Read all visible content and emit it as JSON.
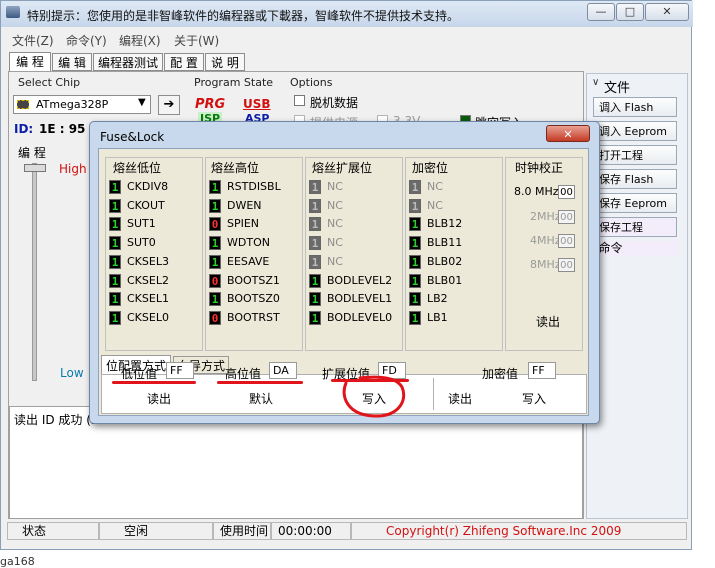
{
  "window": {
    "title": "特别提示：您使用的是非智峰软件的编程器或下載器，智峰软件不提供技术支持。",
    "controls": [
      "—",
      "□",
      "✕"
    ]
  },
  "menu": [
    "文件(Z)",
    "命令(Y)",
    "编程(X)",
    "关于(W)"
  ],
  "tabs": [
    "编 程",
    "编 辑",
    "编程器测试",
    "配 置",
    "说 明"
  ],
  "select_chip": {
    "label": "Select Chip",
    "value": "ATmega328P",
    "id_label": "ID:",
    "id_value": "1E : 95 : 0F"
  },
  "program_state": {
    "label": "Program State",
    "prg": "PRG",
    "isp": "ISP",
    "usb": "USB",
    "asp": "ASP"
  },
  "options": {
    "label": "Options",
    "offline": "脱机数据",
    "supply_power": "提供电源",
    "voltage": "3.3V",
    "jump_write": "跳空写入"
  },
  "program_section": {
    "label": "编 程",
    "high": "High",
    "low": "Low"
  },
  "log_text": "读出 ID 成功 (2",
  "side_panel": {
    "file_header": "文件",
    "buttons": [
      "调入 Flash",
      "调入 Eeprom",
      "打开工程",
      "保存 Flash",
      "保存 Eeprom",
      "保存工程"
    ],
    "cmd_header": "命令"
  },
  "statusbar": {
    "status_label": "状态",
    "status_value": "空闲",
    "time_label": "使用时间",
    "time_value": "00:00:00",
    "copyright": "Copyright(r) Zhifeng Software.Inc 2009"
  },
  "bottom_text": "ga168",
  "dialog": {
    "title": "Fuse&Lock",
    "close": "✕",
    "headers": [
      "熔丝低位",
      "熔丝高位",
      "熔丝扩展位",
      "加密位",
      "时钟校正"
    ],
    "low_bits": [
      {
        "v": "1",
        "n": "CKDIV8"
      },
      {
        "v": "1",
        "n": "CKOUT"
      },
      {
        "v": "1",
        "n": "SUT1"
      },
      {
        "v": "1",
        "n": "SUT0"
      },
      {
        "v": "1",
        "n": "CKSEL3"
      },
      {
        "v": "1",
        "n": "CKSEL2"
      },
      {
        "v": "1",
        "n": "CKSEL1"
      },
      {
        "v": "1",
        "n": "CKSEL0"
      }
    ],
    "high_bits": [
      {
        "v": "1",
        "n": "RSTDISBL"
      },
      {
        "v": "1",
        "n": "DWEN"
      },
      {
        "v": "0",
        "n": "SPIEN"
      },
      {
        "v": "1",
        "n": "WDTON"
      },
      {
        "v": "1",
        "n": "EESAVE"
      },
      {
        "v": "0",
        "n": "BOOTSZ1"
      },
      {
        "v": "1",
        "n": "BOOTSZ0"
      },
      {
        "v": "0",
        "n": "BOOTRST"
      }
    ],
    "ext_bits": [
      {
        "v": "1",
        "n": "NC"
      },
      {
        "v": "1",
        "n": "NC"
      },
      {
        "v": "1",
        "n": "NC"
      },
      {
        "v": "1",
        "n": "NC"
      },
      {
        "v": "1",
        "n": "NC"
      },
      {
        "v": "1",
        "n": "BODLEVEL2"
      },
      {
        "v": "1",
        "n": "BODLEVEL1"
      },
      {
        "v": "1",
        "n": "BODLEVEL0"
      }
    ],
    "lock_bits": [
      {
        "v": "1",
        "n": "NC"
      },
      {
        "v": "1",
        "n": "NC"
      },
      {
        "v": "1",
        "n": "BLB12"
      },
      {
        "v": "1",
        "n": "BLB11"
      },
      {
        "v": "1",
        "n": "BLB02"
      },
      {
        "v": "1",
        "n": "BLB01"
      },
      {
        "v": "1",
        "n": "LB2"
      },
      {
        "v": "1",
        "n": "LB1"
      }
    ],
    "clock": [
      {
        "label": "8.0 MHz",
        "value": "00"
      },
      {
        "label": "2MHz",
        "value": "00"
      },
      {
        "label": "4MHz",
        "value": "00"
      },
      {
        "label": "8MHz",
        "value": "00"
      }
    ],
    "clock_read": "读出",
    "mode_tabs": [
      "位配置方式",
      "向导方式"
    ],
    "low_label": "低位值",
    "low_value": "FF",
    "high_label": "高位值",
    "high_value": "DA",
    "ext_label": "扩展位值",
    "ext_value": "FD",
    "lock_label": "加密值",
    "lock_value": "FF",
    "btn_read": "读出",
    "btn_default": "默认",
    "btn_write": "写入",
    "btn_lock_read": "读出",
    "btn_lock_write": "写入",
    "annotation_color": "#e0141a"
  }
}
